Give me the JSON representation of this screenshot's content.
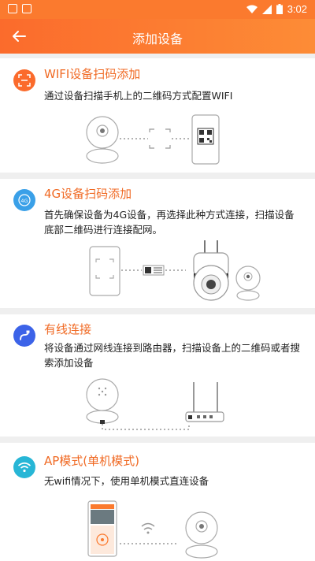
{
  "status_bar": {
    "time": "3:02"
  },
  "app_bar": {
    "title": "添加设备"
  },
  "sections": [
    {
      "title": "WIFI设备扫码添加",
      "description": "通过设备扫描手机上的二维码方式配置WIFI",
      "icon": "scan-icon",
      "icon_color": "#fb6b2c"
    },
    {
      "title": "4G设备扫码添加",
      "description": "首先确保设备为4G设备，再选择此种方式连接，扫描设备底部二维码进行连接配网。",
      "icon": "4g-icon",
      "icon_color": "#3aa0e8"
    },
    {
      "title": "有线连接",
      "description": "将设备通过网线连接到路由器，扫描设备上的二维码或者搜索添加设备",
      "icon": "cable-icon",
      "icon_color": "#3c63e8"
    },
    {
      "title": "AP模式(单机模式)",
      "description": "无wifi情况下，使用单机模式直连设备",
      "icon": "wifi-icon",
      "icon_color": "#27b6d6"
    }
  ],
  "colors": {
    "accent": "#fb6b2c",
    "heading": "#f06a24",
    "background": "#efefef"
  }
}
